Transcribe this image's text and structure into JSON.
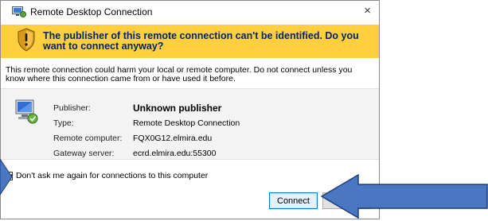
{
  "window": {
    "title": "Remote Desktop Connection",
    "close_glyph": "×",
    "app_icon": "remote-desktop-icon"
  },
  "warning": {
    "icon": "shield-warning-icon",
    "heading": "The publisher of this remote connection can't be identified. Do you want to connect anyway?",
    "message": "This remote connection could harm your local or remote computer. Do not connect unless you know where this connection came from or have used it before."
  },
  "details": {
    "icon": "computer-icon",
    "rows": [
      {
        "label": "Publisher:",
        "value": "Unknown publisher"
      },
      {
        "label": "Type:",
        "value": "Remote Desktop Connection"
      },
      {
        "label": "Remote computer:",
        "value": "FQX0G12.elmira.edu"
      },
      {
        "label": "Gateway server:",
        "value": "ecrd.elmira.edu:55300"
      }
    ]
  },
  "checkbox": {
    "label": "Don't ask me again for connections to this computer",
    "checked": true
  },
  "buttons": {
    "connect": "Connect",
    "cancel": ""
  },
  "annotations": {
    "arrow_color": "#4a77c1",
    "arrow_border": "#1f3d7a"
  },
  "colors": {
    "warning_band": "#ffcf3f",
    "warning_text": "#00236e",
    "info_panel": "#f3f3f3"
  }
}
